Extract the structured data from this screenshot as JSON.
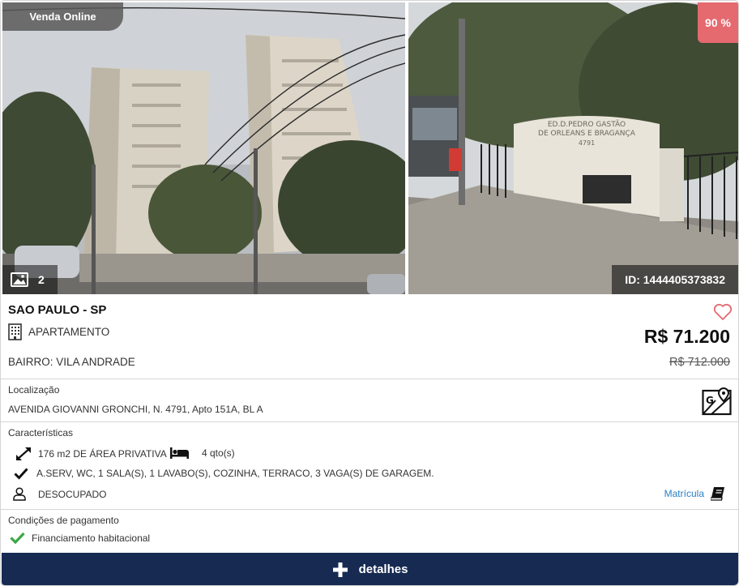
{
  "badges": {
    "sale_type": "Venda Online",
    "discount": "90 %"
  },
  "photos": {
    "count": "2",
    "id_label": "ID: 1444405373832"
  },
  "property": {
    "city": "SAO PAULO - SP",
    "type": "APARTAMENTO",
    "neighborhood": "BAIRRO: VILA ANDRADE",
    "price": "R$ 71.200",
    "old_price": "R$ 712.000"
  },
  "location": {
    "label": "Localização",
    "address": "AVENIDA GIOVANNI GRONCHI, N. 4791, Apto 151A, BL A"
  },
  "features": {
    "label": "Características",
    "area": "176 m2 DE ÁREA PRIVATIVA",
    "rooms": "4 qto(s)",
    "extras": "A.SERV, WC, 1 SALA(S), 1 LAVABO(S), COZINHA, TERRACO, 3 VAGA(S) DE GARAGEM.",
    "occupancy": "DESOCUPADO",
    "registry_link": "Matrícula"
  },
  "payment": {
    "label": "Condições de pagamento",
    "option": "Financiamento habitacional"
  },
  "actions": {
    "details": "detalhes"
  },
  "photo_signage": {
    "line1": "ED.D.PEDRO GASTÃO",
    "line2": "DE ORLEANS E BRAGANÇA",
    "line3": "4791"
  },
  "colors": {
    "accent_navy": "#162a52",
    "discount_red": "#e46a6f",
    "link_blue": "#2a7fc4",
    "check_green": "#3aa845"
  }
}
